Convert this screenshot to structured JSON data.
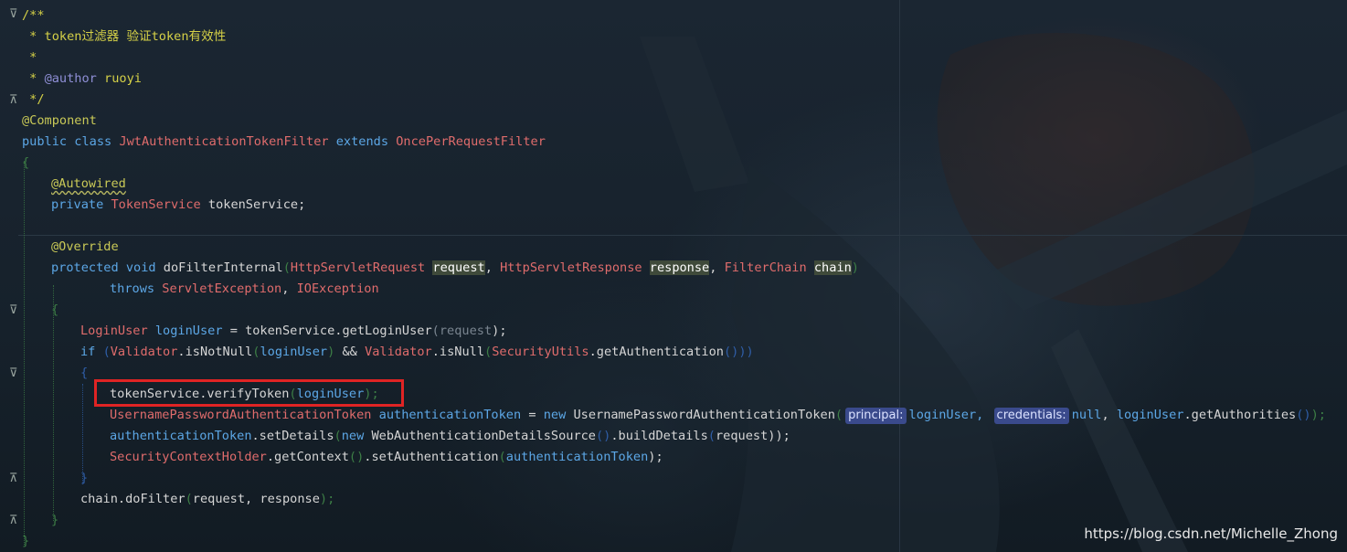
{
  "editor": {
    "language": "Java",
    "colors": {
      "background": "#162029",
      "comment": "#d4d047",
      "keyword": "#5ca7e6",
      "class_name": "#e06c6c",
      "annotation": "#c9c957",
      "highlight_box": "#e02424",
      "param_hint": "#3a4a8c"
    },
    "lines": {
      "l1": "/**",
      "l2": " * token过滤器 验证token有效性",
      "l3": " *",
      "l4_prefix": " * ",
      "l4_tag": "@author",
      "l4_value": " ruoyi",
      "l5": " */",
      "l6": "@Component",
      "l7_kw1": "public class ",
      "l7_cls": "JwtAuthenticationTokenFilter",
      "l7_kw2": " extends ",
      "l7_cls2": "OncePerRequestFilter",
      "l8": "{",
      "l9": "@Autowired",
      "l10_kw": "private ",
      "l10_type": "TokenService",
      "l10_name": " tokenService;",
      "l11": "@Override",
      "l12_kw": "protected void ",
      "l12_method": "doFilterInternal",
      "l12_open": "(",
      "l12_t1": "HttpServletRequest ",
      "l12_p1": "request",
      "l12_c1": ", ",
      "l12_t2": "HttpServletResponse ",
      "l12_p2": "response",
      "l12_c2": ", ",
      "l12_t3": "FilterChain ",
      "l12_p3": "chain",
      "l12_close": ")",
      "l13_kw": "throws ",
      "l13_e1": "ServletException",
      "l13_c": ", ",
      "l13_e2": "IOException",
      "l14": "{",
      "l15_type": "LoginUser",
      "l15_var": " loginUser",
      "l15_a": " = tokenService.getLoginUser",
      "l15_o": "(",
      "l15_arg": "request",
      "l15_c": ");",
      "l16_kw": "if ",
      "l16_o1": "(",
      "l16_cls1": "Validator",
      "l16_m1": ".isNotNull",
      "l16_o2": "(",
      "l16_arg1": "loginUser",
      "l16_c2": ")",
      "l16_and": " && ",
      "l16_cls2": "Validator",
      "l16_m2": ".isNull",
      "l16_o3": "(",
      "l16_cls3": "SecurityUtils",
      "l16_m3": ".getAuthentication",
      "l16_o4": "()",
      "l16_c4": "))",
      "l17": "{",
      "l18_a": "tokenService.verifyToken",
      "l18_o": "(",
      "l18_arg": "loginUser",
      "l18_c": ");",
      "l19_type": "UsernamePasswordAuthenticationToken",
      "l19_var": " authenticationToken",
      "l19_eq": " = ",
      "l19_new": "new ",
      "l19_ctor": "UsernamePasswordAuthenticationToken",
      "l19_o": "(",
      "l19_hint1": "principal:",
      "l19_arg1": "loginUser, ",
      "l19_hint2": "credentials:",
      "l19_null": "null",
      "l19_comma": ", ",
      "l19_arg3": "loginUser",
      "l19_m": ".getAuthorities",
      "l19_o2": "()",
      "l19_c": ");",
      "l20_var": "authenticationToken",
      "l20_m": ".setDetails",
      "l20_o": "(",
      "l20_new": "new ",
      "l20_ctor": "WebAuthenticationDetailsSource",
      "l20_o2": "()",
      "l20_m2": ".buildDetails",
      "l20_o3": "(",
      "l20_arg": "request",
      "l20_c": "));",
      "l21_cls": "SecurityContextHolder",
      "l21_m": ".getContext",
      "l21_o": "()",
      "l21_m2": ".setAuthentication",
      "l21_o2": "(",
      "l21_arg": "authenticationToken",
      "l21_c": ");",
      "l22": "}",
      "l23_a": "chain.doFilter",
      "l23_o": "(",
      "l23_args": "request, response",
      "l23_c": ");",
      "l24": "}",
      "l25": "}"
    }
  },
  "icons": {
    "fold": "fold-marker-icon"
  },
  "watermark": "https://blog.csdn.net/Michelle_Zhong"
}
